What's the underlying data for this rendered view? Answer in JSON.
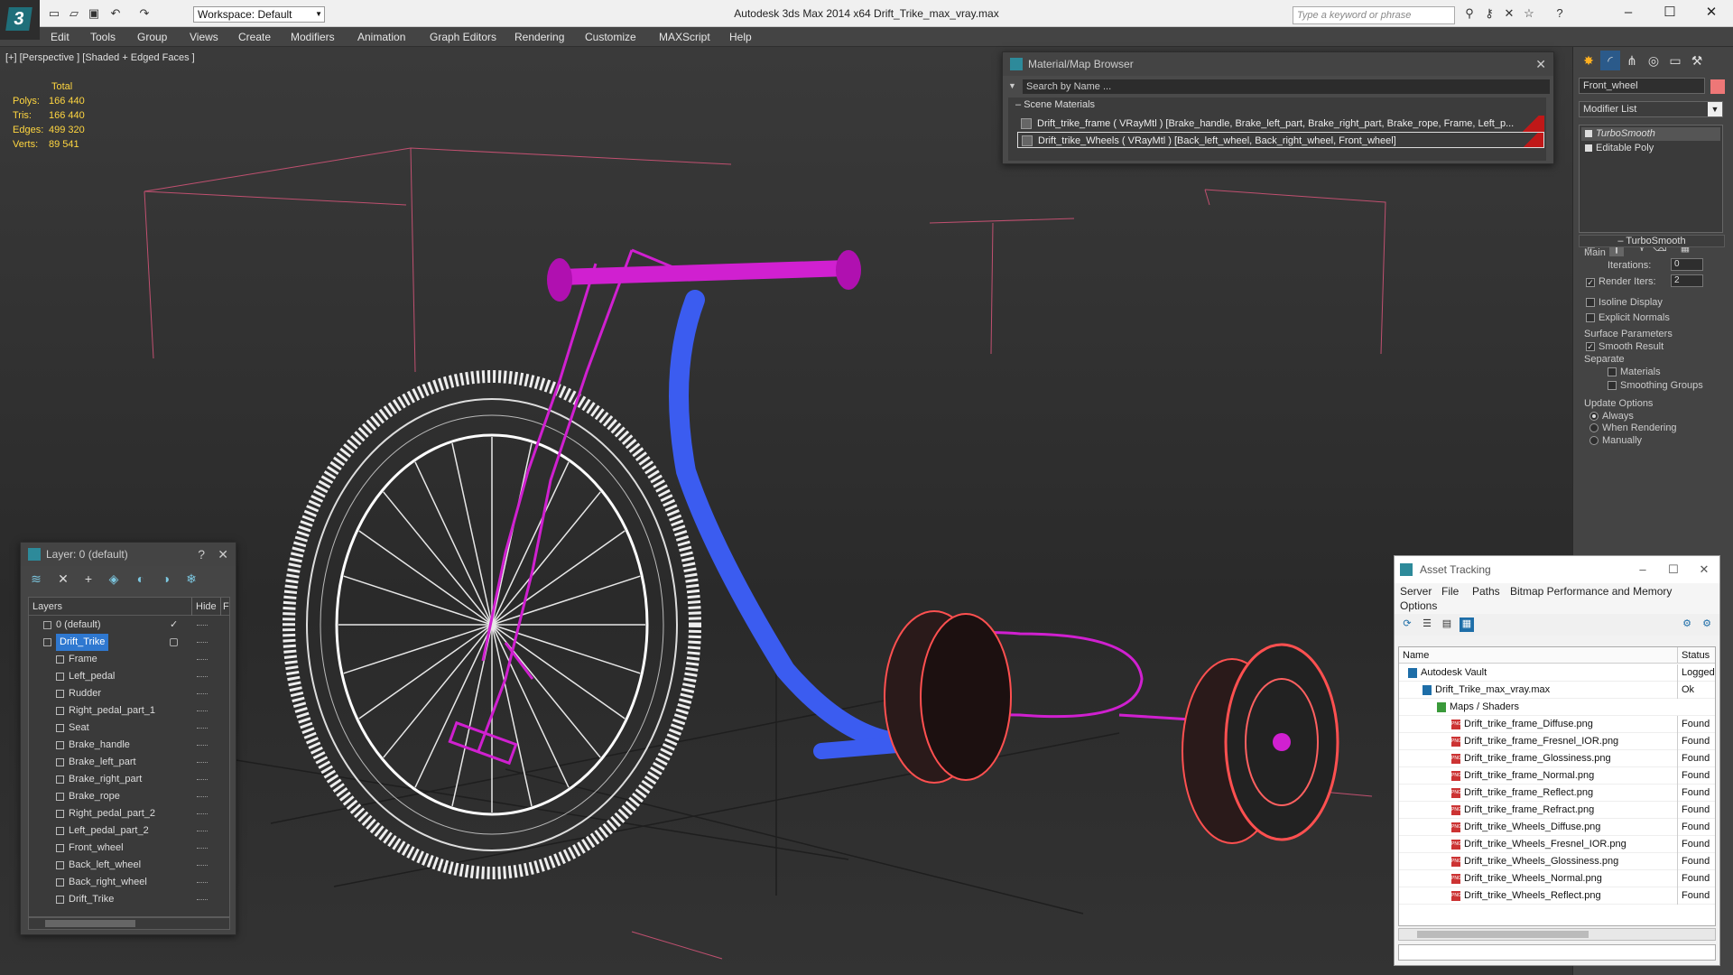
{
  "app": {
    "title": "Autodesk 3ds Max  2014 x64     Drift_Trike_max_vray.max",
    "workspace": "Workspace: Default",
    "search_placeholder": "Type a keyword or phrase"
  },
  "menu": [
    "Edit",
    "Tools",
    "Group",
    "Views",
    "Create",
    "Modifiers",
    "Animation",
    "Graph Editors",
    "Rendering",
    "Customize",
    "MAXScript",
    "Help"
  ],
  "viewport": {
    "label": "[+] [Perspective ] [Shaded + Edged Faces ]",
    "stats": {
      "header": "Total",
      "rows": [
        {
          "label": "Polys:",
          "value": "166 440"
        },
        {
          "label": "Tris:",
          "value": "166 440"
        },
        {
          "label": "Edges:",
          "value": "499 320"
        },
        {
          "label": "Verts:",
          "value": "89 541"
        }
      ]
    }
  },
  "material_browser": {
    "title": "Material/Map Browser",
    "search": "Search by Name ...",
    "section": "Scene Materials",
    "materials": [
      "Drift_trike_frame  ( VRayMtl )  [Brake_handle, Brake_left_part, Brake_right_part, Brake_rope, Frame, Left_p...",
      "Drift_trike_Wheels  ( VRayMtl )  [Back_left_wheel, Back_right_wheel, Front_wheel]"
    ]
  },
  "command_panel": {
    "object_name": "Front_wheel",
    "modifier_list": "Modifier List",
    "stack": [
      "TurboSmooth",
      "Editable Poly"
    ],
    "turbosmooth": {
      "title": "TurboSmooth",
      "main": "Main",
      "iterations_label": "Iterations:",
      "iterations": "0",
      "render_iters_label": "Render Iters:",
      "render_iters": "2",
      "isoline": "Isoline Display",
      "explicit": "Explicit Normals",
      "surface": "Surface Parameters",
      "smooth": "Smooth Result",
      "separate": "Separate",
      "materials": "Materials",
      "smoothing_groups": "Smoothing Groups",
      "update": "Update Options",
      "always": "Always",
      "when_rendering": "When Rendering",
      "manually": "Manually"
    }
  },
  "layer_panel": {
    "title": "Layer: 0 (default)",
    "help": "?",
    "col_layers": "Layers",
    "col_hide": "Hide",
    "col_f": "F",
    "layers": [
      "0 (default)",
      "Drift_Trike"
    ],
    "objects": [
      "Frame",
      "Left_pedal",
      "Rudder",
      "Right_pedal_part_1",
      "Seat",
      "Brake_handle",
      "Brake_left_part",
      "Brake_right_part",
      "Brake_rope",
      "Right_pedal_part_2",
      "Left_pedal_part_2",
      "Front_wheel",
      "Back_left_wheel",
      "Back_right_wheel",
      "Drift_Trike"
    ]
  },
  "asset_tracking": {
    "title": "Asset Tracking",
    "menu": [
      "Server",
      "File",
      "Paths",
      "Bitmap Performance and Memory",
      "Options"
    ],
    "col_name": "Name",
    "col_status": "Status",
    "rows": [
      {
        "name": "Autodesk Vault",
        "status": "Logged O"
      },
      {
        "name": "Drift_Trike_max_vray.max",
        "status": "Ok"
      },
      {
        "name": "Maps / Shaders",
        "status": ""
      },
      {
        "name": "Drift_trike_frame_Diffuse.png",
        "status": "Found"
      },
      {
        "name": "Drift_trike_frame_Fresnel_IOR.png",
        "status": "Found"
      },
      {
        "name": "Drift_trike_frame_Glossiness.png",
        "status": "Found"
      },
      {
        "name": "Drift_trike_frame_Normal.png",
        "status": "Found"
      },
      {
        "name": "Drift_trike_frame_Reflect.png",
        "status": "Found"
      },
      {
        "name": "Drift_trike_frame_Refract.png",
        "status": "Found"
      },
      {
        "name": "Drift_trike_Wheels_Diffuse.png",
        "status": "Found"
      },
      {
        "name": "Drift_trike_Wheels_Fresnel_IOR.png",
        "status": "Found"
      },
      {
        "name": "Drift_trike_Wheels_Glossiness.png",
        "status": "Found"
      },
      {
        "name": "Drift_trike_Wheels_Normal.png",
        "status": "Found"
      },
      {
        "name": "Drift_trike_Wheels_Reflect.png",
        "status": "Found"
      }
    ]
  },
  "colors": {
    "frame_wire": "#d020d0",
    "handlebar": "#3b5cf0",
    "wheels_wire": "#ff5050",
    "stats": "#ffd640",
    "selection": "#2f78d0"
  }
}
